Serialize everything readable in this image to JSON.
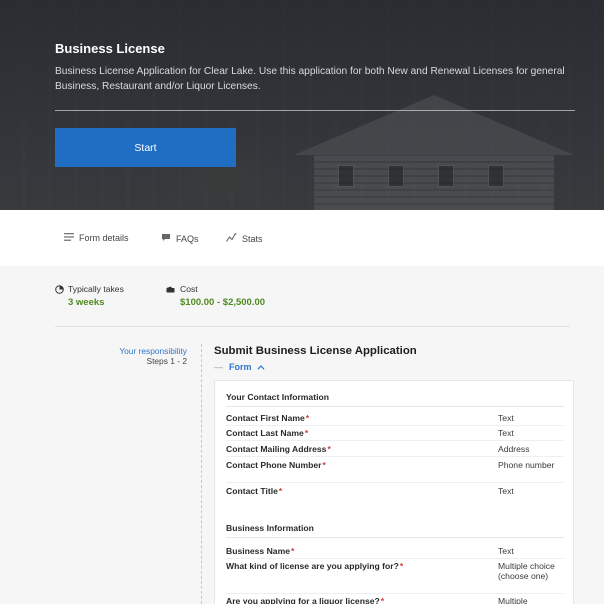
{
  "hero": {
    "title": "Business License",
    "description": "Business License Application for Clear Lake. Use this application for both New and Renewal Licenses for general Business, Restaurant and/or Liquor Licenses.",
    "start_label": "Start"
  },
  "tabs": [
    {
      "label": "Form details",
      "icon": "list-icon"
    },
    {
      "label": "FAQs",
      "icon": "chat-bubble-icon"
    },
    {
      "label": "Stats",
      "icon": "sparkle-chart-icon"
    }
  ],
  "meta": {
    "duration_label": "Typically takes",
    "duration_value": "3 weeks",
    "cost_label": "Cost",
    "cost_value": "$100.00 - $2,500.00"
  },
  "step": {
    "responsibility": "Your responsibility",
    "steps": "Steps 1 - 2",
    "title": "Submit Business License Application",
    "form_toggle": "Form",
    "sections": [
      {
        "title": "Your Contact Information",
        "fields": [
          {
            "name": "Contact First Name",
            "type": "Text"
          },
          {
            "name": "Contact Last Name",
            "type": "Text"
          },
          {
            "name": "Contact Mailing Address",
            "type": "Address"
          },
          {
            "name": "Contact Phone Number",
            "type": "Phone number"
          },
          {
            "name": "Contact Title",
            "type": "Text"
          }
        ]
      },
      {
        "title": "Business Information",
        "fields": [
          {
            "name": "Business Name",
            "type": "Text"
          },
          {
            "name": "What kind of license are you applying for?",
            "type": "Multiple choice (choose one)"
          },
          {
            "name": "Are you applying for a liquor license?",
            "type": "Multiple"
          }
        ]
      }
    ]
  },
  "colors": {
    "accent_blue": "#1f6ec4",
    "link_blue": "#2f77c9",
    "green_value": "#4d8a1f",
    "required_red": "#d23b3b"
  }
}
